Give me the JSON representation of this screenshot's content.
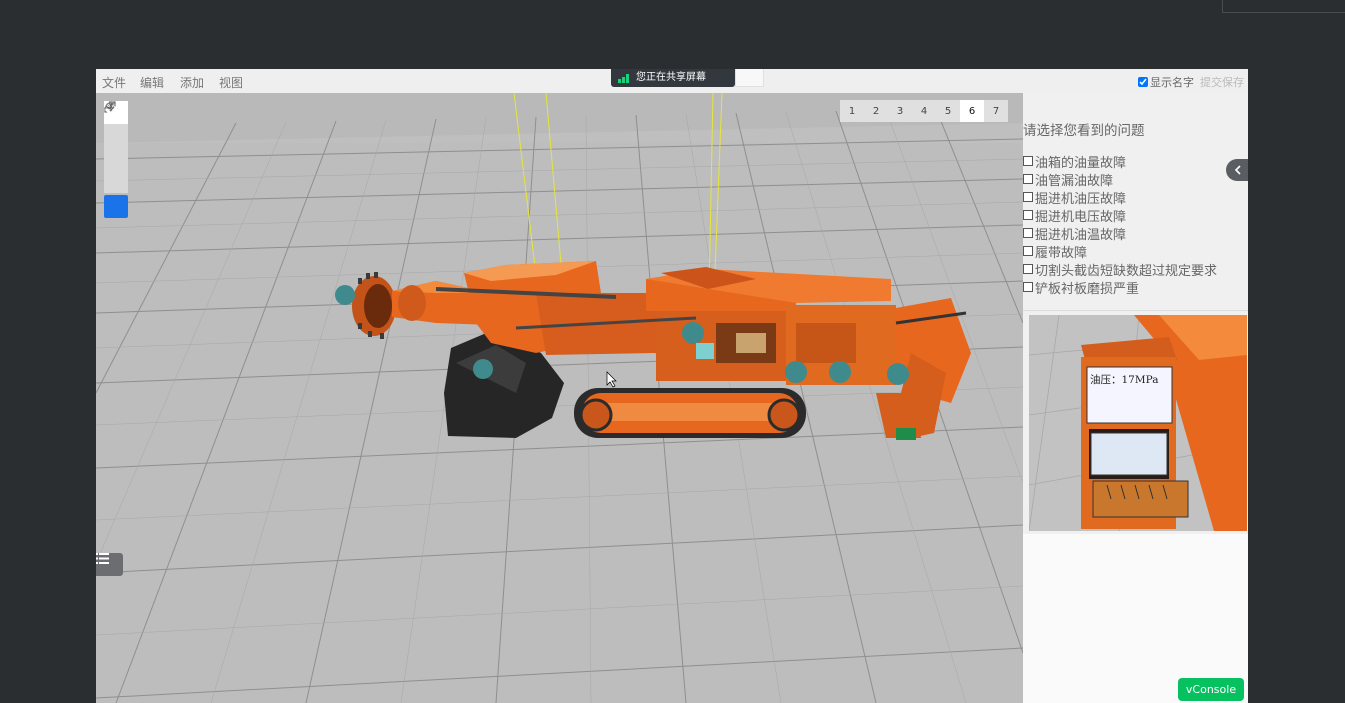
{
  "menubar": {
    "items": [
      "文件",
      "编辑",
      "添加",
      "视图"
    ],
    "show_names_label": "显示名字",
    "show_names_checked": true,
    "submit_label": "提交保存"
  },
  "share_banner": {
    "text": "您正在共享屏幕"
  },
  "toolbar": {
    "tools": [
      "move-icon",
      "rotate-icon",
      "scale-icon",
      "ruler-icon",
      "checkbox-checked-icon"
    ]
  },
  "pages": {
    "items": [
      "1",
      "2",
      "3",
      "4",
      "5",
      "6",
      "7"
    ],
    "active": "6"
  },
  "question_panel": {
    "title": "请选择您看到的问题",
    "options": [
      "油箱的油量故障",
      "油管漏油故障",
      "掘进机油压故障",
      "掘进机电压故障",
      "掘进机油温故障",
      "履带故障",
      "切割头截齿短缺数超过规定要求",
      "铲板衬板磨损严重"
    ],
    "preview_label": "油压：17MPa"
  },
  "vconsole": {
    "label": "vConsole"
  },
  "colors": {
    "accent_green": "#19d27a",
    "machine_orange": "#e8671e",
    "hotspot_teal": "#3e8a8c",
    "checkbox_blue": "#1a73e8",
    "vconsole_green": "#07c160"
  }
}
